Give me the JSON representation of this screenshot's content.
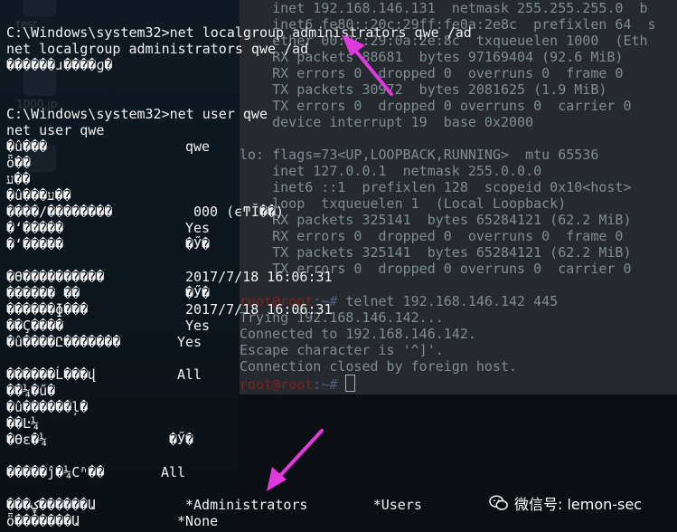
{
  "background_terminal": {
    "lines": [
      "    inet 192.168.146.131  netmask 255.255.255.0  b",
      "    inet6 fe80::20c:29ff:fe0a:2e8c  prefixlen 64  s",
      "    ether 00:0c:29:0a:2e:8c  txqueuelen 1000  (Eth",
      "    RX packets 88681  bytes 97169404 (92.6 MiB)",
      "    RX errors 0  dropped 0  overruns 0  frame 0",
      "    TX packets 30972  bytes 2081625 (1.9 MiB)",
      "    TX errors 0  dropped 0 overruns 0  carrier 0",
      "    device interrupt 19  base 0x2000",
      "",
      "lo: flags=73<UP,LOOPBACK,RUNNING>  mtu 65536",
      "    inet 127.0.0.1  netmask 255.0.0.0",
      "    inet6 ::1  prefixlen 128  scopeid 0x10<host>",
      "    loop  txqueuelen 1  (Local Loopback)",
      "    RX packets 325141  bytes 65284121 (62.2 MiB)",
      "    RX errors 0  dropped 0  overruns 0  frame 0",
      "    TX packets 325141  bytes 65284121 (62.2 MiB)",
      "    TX errors 0  dropped 0 overruns 0  carrier 0",
      "",
      "root@root:~# telnet 192.168.146.142 445",
      "Trying 192.168.146.142...",
      "Connected to 192.168.146.142.",
      "Escape character is '^]'.",
      "Connection closed by foreign host."
    ],
    "prompt_user": "root@root",
    "prompt_path": ":~#",
    "prompt_telnet_cmd": " telnet 192.168.146.142 445"
  },
  "desktop": {
    "labels": [
      "test",
      "1000.jp"
    ]
  },
  "cmd": {
    "prompt1": "C:\\Windows\\system32>net localgroup administrators qwe /ad",
    "echo1": "net localgroup administrators qwe /ad",
    "result1": "������ɹ����ɡ�",
    "prompt2": "C:\\Windows\\system32>net user qwe",
    "echo2": "net user qwe",
    "fields": [
      {
        "label": "�û���",
        "value": "qwe"
      },
      {
        "label": "ȫ��",
        "value": ""
      },
      {
        "label": "ע��",
        "value": ""
      },
      {
        "label": "�û���ע��",
        "value": ""
      },
      {
        "label": "����/��������",
        "value": "000 (ϵͳĬ��)"
      },
      {
        "label": "�ʻ�����",
        "value": "Yes"
      },
      {
        "label": "�ʻ�����",
        "value": "�Ӳ�"
      },
      {
        "label": "",
        "value": ""
      },
      {
        "label": "�ϴ����������",
        "value": "2017/7/18 16:06:31"
      },
      {
        "label": "������ ��",
        "value": "�Ӳ�"
      },
      {
        "label": "������ɸ���",
        "value": "2017/7/18 16:06:31"
      },
      {
        "label": "��Ҫ����",
        "value": "Yes"
      },
      {
        "label": "�û����Ը�������",
        "value": "Yes"
      },
      {
        "label": "",
        "value": ""
      },
      {
        "label": "������Ĺ���վ",
        "value": "All"
      },
      {
        "label": "��¼�ű�",
        "value": ""
      },
      {
        "label": "�û������ļ�",
        "value": ""
      },
      {
        "label": "��Ŀ¼",
        "value": ""
      },
      {
        "label": "�ϴε�¼",
        "value": "�Ӳ�"
      },
      {
        "label": "",
        "value": ""
      },
      {
        "label": "�����ĵ�¼Сʱ��",
        "value": "All"
      },
      {
        "label": "",
        "value": ""
      },
      {
        "label": "���ؼ������Ա",
        "value": "*Administrators        *Users"
      },
      {
        "label": "ȫ�������Ա",
        "value": "*None"
      }
    ]
  },
  "watermark": {
    "text": "微信号: lemon-sec"
  },
  "colors": {
    "arrow": "#e03adf",
    "cmd_text": "#f2f2f2",
    "bg_terminal_text": "#7e8c95",
    "prompt_red": "#7f2222"
  }
}
